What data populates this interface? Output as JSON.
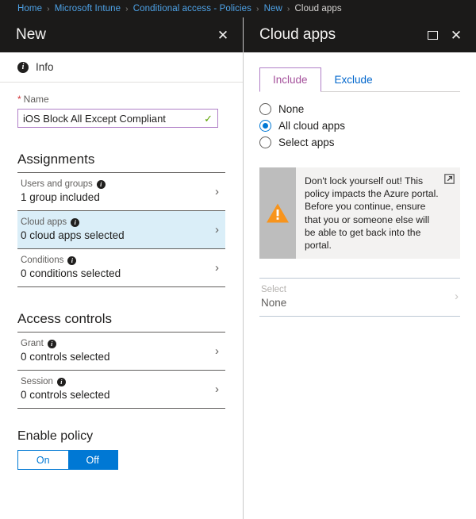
{
  "breadcrumb": {
    "separator": "›",
    "items": [
      {
        "label": "Home",
        "current": false
      },
      {
        "label": "Microsoft Intune",
        "current": false
      },
      {
        "label": "Conditional access - Policies",
        "current": false
      },
      {
        "label": "New",
        "current": false
      },
      {
        "label": "Cloud apps",
        "current": true
      }
    ]
  },
  "left_blade": {
    "title": "New",
    "close_label": "✕",
    "info_bar": {
      "icon": "info-icon",
      "glyph": "i",
      "label": "Info"
    },
    "name_field": {
      "label": "Name",
      "required_marker": "*",
      "value": "iOS Block All Except Compliant",
      "placeholder": "",
      "valid_glyph": "✓",
      "border_color": "#b07fc7",
      "valid_color": "#5ba300"
    },
    "assignments": {
      "title": "Assignments",
      "rows": [
        {
          "label": "Users and groups",
          "value": "1 group included",
          "selected": false,
          "info_glyph": "i",
          "chevron": "›"
        },
        {
          "label": "Cloud apps",
          "value": "0 cloud apps selected",
          "selected": true,
          "info_glyph": "i",
          "chevron": "›"
        },
        {
          "label": "Conditions",
          "value": "0 conditions selected",
          "selected": false,
          "info_glyph": "i",
          "chevron": "›"
        }
      ]
    },
    "access_controls": {
      "title": "Access controls",
      "rows": [
        {
          "label": "Grant",
          "value": "0 controls selected",
          "selected": false,
          "info_glyph": "i",
          "chevron": "›"
        },
        {
          "label": "Session",
          "value": "0 controls selected",
          "selected": false,
          "info_glyph": "i",
          "chevron": "›"
        }
      ]
    },
    "enable_policy": {
      "label": "Enable policy",
      "on_label": "On",
      "off_label": "Off",
      "selected": "Off",
      "accent_color": "#0078d4"
    },
    "selected_row_color": "#daeef8"
  },
  "right_blade": {
    "title": "Cloud apps",
    "restore_label": "restore",
    "close_label": "✕",
    "tabs": [
      {
        "label": "Include",
        "active": true
      },
      {
        "label": "Exclude",
        "active": false
      }
    ],
    "active_tab_color": "#a4509b",
    "radios": [
      {
        "label": "None",
        "checked": false
      },
      {
        "label": "All cloud apps",
        "checked": true
      },
      {
        "label": "Select apps",
        "checked": false
      }
    ],
    "warning": {
      "icon": "warning-triangle-icon",
      "text": "Don't lock yourself out! This policy impacts the Azure portal. Before you continue, ensure that you or someone else will be able to get back into the portal.",
      "link_icon": "external-link-icon",
      "icon_color": "#f7941d",
      "panel_color": "#f3f2f1"
    },
    "select_row": {
      "label": "Select",
      "value": "None",
      "chevron": "›",
      "disabled": true
    }
  }
}
